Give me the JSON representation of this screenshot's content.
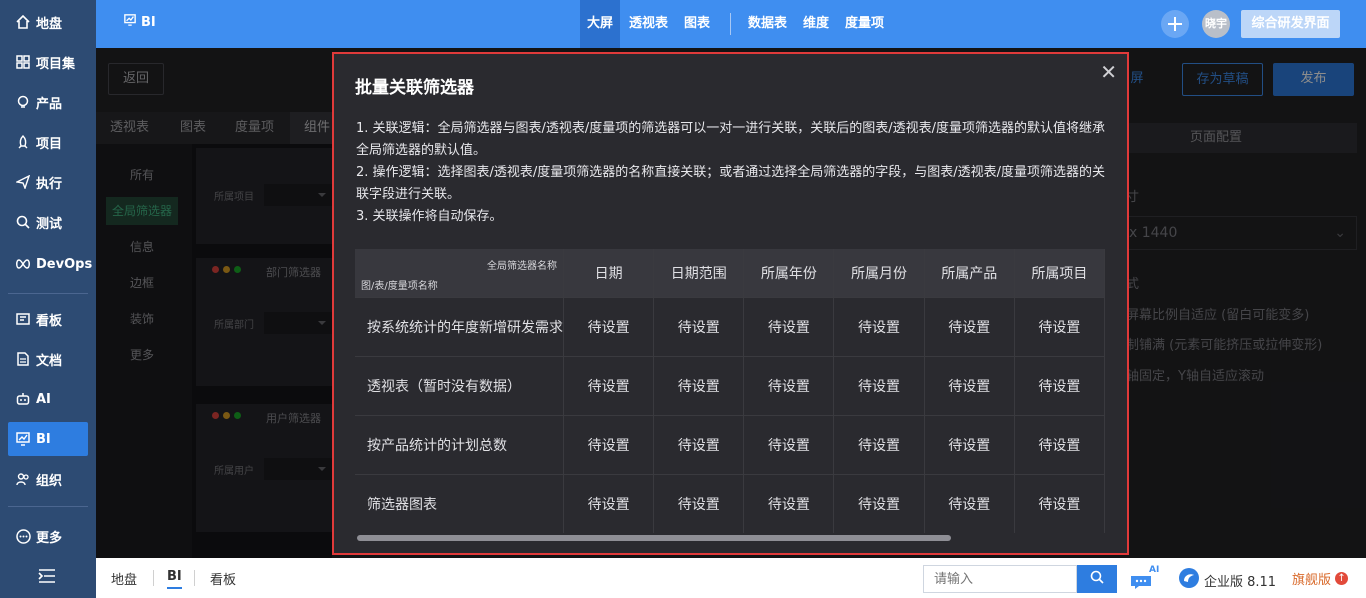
{
  "sidebar": {
    "items": [
      {
        "label": "地盘",
        "icon": "home-icon"
      },
      {
        "label": "项目集",
        "icon": "grid-icon"
      },
      {
        "label": "产品",
        "icon": "bulb-icon"
      },
      {
        "label": "项目",
        "icon": "rocket-icon"
      },
      {
        "label": "执行",
        "icon": "send-icon"
      },
      {
        "label": "测试",
        "icon": "search-icon"
      },
      {
        "label": "DevOps",
        "icon": "infinity-icon"
      },
      {
        "label": "看板",
        "icon": "kanban-icon"
      },
      {
        "label": "文档",
        "icon": "doc-icon"
      },
      {
        "label": "AI",
        "icon": "robot-icon"
      },
      {
        "label": "BI",
        "icon": "chart-icon"
      },
      {
        "label": "组织",
        "icon": "people-icon"
      },
      {
        "label": "更多",
        "icon": "more-icon"
      }
    ],
    "active": "BI"
  },
  "header": {
    "module": "BI",
    "nav": [
      {
        "label": "大屏",
        "active": true
      },
      {
        "label": "透视表"
      },
      {
        "label": "图表"
      },
      {
        "label": "数据表"
      },
      {
        "label": "维度"
      },
      {
        "label": "度量项"
      }
    ],
    "avatar_text": "晓宇",
    "workspace_button": "综合研发界面"
  },
  "editor": {
    "back_label": "返回",
    "tabs": [
      "透视表",
      "图表",
      "度量项",
      "组件"
    ],
    "categories": [
      "所有",
      "全局筛选器",
      "信息",
      "边框",
      "装饰",
      "更多"
    ],
    "active_category": "全局筛选器",
    "cards": [
      {
        "title": "",
        "field": "所属项目"
      },
      {
        "title": "部门筛选器",
        "field": "所属部门"
      },
      {
        "title": "用户筛选器",
        "field": "所属用户"
      }
    ],
    "right": {
      "btn_screen": "屏",
      "btn_draft": "存为草稿",
      "btn_publish": "发布",
      "config_tab": "页面配置",
      "size_label": "寸",
      "size_value": "x 1440",
      "mode_label": "式",
      "opt1": "屏幕比例自适应 (留白可能变多)",
      "opt2": "制铺满 (元素可能挤压或拉伸变形)",
      "opt3": "轴固定，Y轴自适应滚动"
    }
  },
  "modal": {
    "title": "批量关联筛选器",
    "close_icon": "close-icon",
    "desc": [
      "1. 关联逻辑：全局筛选器与图表/透视表/度量项的筛选器可以一对一进行关联，关联后的图表/透视表/度量项筛选器的默认值将继承全局筛选器的默认值。",
      "2. 操作逻辑：选择图表/透视表/度量项筛选器的名称直接关联；或者通过选择全局筛选器的字段，与图表/透视表/度量项筛选器的关联字段进行关联。",
      "3. 关联操作将自动保存。"
    ],
    "table": {
      "corner_top": "全局筛选器名称",
      "corner_bottom": "图/表/度量项名称",
      "columns": [
        "日期",
        "日期范围",
        "所属年份",
        "所属月份",
        "所属产品",
        "所属项目"
      ],
      "rows": [
        {
          "name": "按系统统计的年度新增研发需求",
          "cells": [
            "待设置",
            "待设置",
            "待设置",
            "待设置",
            "待设置",
            "待设置"
          ]
        },
        {
          "name": "透视表（暂时没有数据）",
          "cells": [
            "待设置",
            "待设置",
            "待设置",
            "待设置",
            "待设置",
            "待设置"
          ]
        },
        {
          "name": "按产品统计的计划总数",
          "cells": [
            "待设置",
            "待设置",
            "待设置",
            "待设置",
            "待设置",
            "待设置"
          ]
        },
        {
          "name": "筛选器图表",
          "cells": [
            "待设置",
            "待设置",
            "待设置",
            "待设置",
            "待设置",
            "待设置"
          ]
        }
      ]
    }
  },
  "footer": {
    "tabs": [
      "地盘",
      "BI",
      "看板"
    ],
    "active_tab": "BI",
    "search_placeholder": "请输入",
    "ai_badge": "AI",
    "edition": "企业版 8.11",
    "flagship": "旗舰版"
  },
  "colors": {
    "sidebar_bg": "#2d4b73",
    "header_bg": "#3f8ef0",
    "accent": "#2e7de0",
    "modal_border": "#e03a3a",
    "modal_bg": "#2a2a2f"
  }
}
